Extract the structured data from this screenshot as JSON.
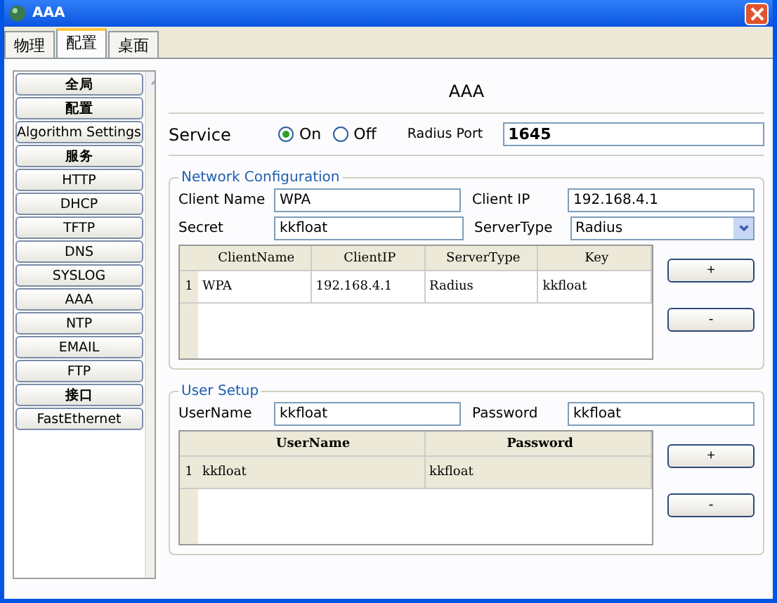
{
  "window": {
    "title": "AAA"
  },
  "tabs": [
    {
      "label": "物理",
      "selected": false
    },
    {
      "label": "配置",
      "selected": true
    },
    {
      "label": "桌面",
      "selected": false
    }
  ],
  "sidebar": {
    "items": [
      {
        "label": "全局",
        "kind": "header"
      },
      {
        "label": "配置",
        "kind": "header"
      },
      {
        "label": "Algorithm Settings",
        "kind": "item"
      },
      {
        "label": "服务",
        "kind": "header"
      },
      {
        "label": "HTTP",
        "kind": "item"
      },
      {
        "label": "DHCP",
        "kind": "item"
      },
      {
        "label": "TFTP",
        "kind": "item"
      },
      {
        "label": "DNS",
        "kind": "item"
      },
      {
        "label": "SYSLOG",
        "kind": "item"
      },
      {
        "label": "AAA",
        "kind": "item"
      },
      {
        "label": "NTP",
        "kind": "item"
      },
      {
        "label": "EMAIL",
        "kind": "item"
      },
      {
        "label": "FTP",
        "kind": "item"
      },
      {
        "label": "接口",
        "kind": "header"
      },
      {
        "label": "FastEthernet",
        "kind": "item"
      }
    ]
  },
  "heading": "AAA",
  "service": {
    "label": "Service",
    "options": [
      {
        "label": "On",
        "selected": true
      },
      {
        "label": "Off",
        "selected": false
      }
    ],
    "port_label": "Radius Port",
    "port_value": "1645"
  },
  "network": {
    "title": "Network Configuration",
    "client_name_label": "Client Name",
    "client_name": "WPA",
    "client_ip_label": "Client IP",
    "client_ip": "192.168.4.1",
    "secret_label": "Secret",
    "secret": "kkfloat",
    "server_type_label": "ServerType",
    "server_type": "Radius",
    "table": {
      "columns": [
        "ClientName",
        "ClientIP",
        "ServerType",
        "Key"
      ],
      "rows": [
        {
          "index": "1",
          "selected": false,
          "cells": [
            "WPA",
            "192.168.4.1",
            "Radius",
            "kkfloat"
          ]
        }
      ]
    },
    "buttons": [
      "+",
      "-"
    ]
  },
  "users": {
    "title": "User Setup",
    "username_label": "UserName",
    "username": "kkfloat",
    "password_label": "Password",
    "password": "kkfloat",
    "table": {
      "columns": [
        "UserName",
        "Password"
      ],
      "rows": [
        {
          "index": "1",
          "selected": true,
          "cells": [
            "kkfloat",
            "kkfloat"
          ]
        }
      ]
    },
    "buttons": [
      "+",
      "-"
    ]
  }
}
